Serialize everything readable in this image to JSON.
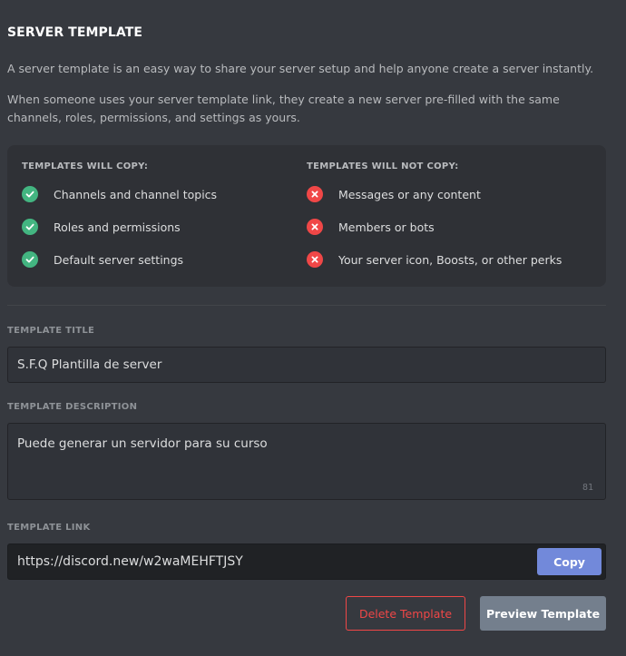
{
  "header": {
    "title": "SERVER TEMPLATE",
    "description_1": "A server template is an easy way to share your server setup and help anyone create a server instantly.",
    "description_2": "When someone uses your server template link, they create a new server pre-filled with the same channels, roles, permissions, and settings as yours."
  },
  "copy_info": {
    "will_copy": {
      "heading": "TEMPLATES WILL COPY:",
      "items": [
        "Channels and channel topics",
        "Roles and permissions",
        "Default server settings"
      ]
    },
    "will_not_copy": {
      "heading": "TEMPLATES WILL NOT COPY:",
      "items": [
        "Messages or any content",
        "Members or bots",
        "Your server icon, Boosts, or other perks"
      ]
    }
  },
  "template_title": {
    "label": "TEMPLATE TITLE",
    "value": "S.F.Q Plantilla de server"
  },
  "template_description": {
    "label": "TEMPLATE DESCRIPTION",
    "value": "Puede generar un servidor para su curso",
    "remaining_chars": "81"
  },
  "template_link": {
    "label": "TEMPLATE LINK",
    "url": "https://discord.new/w2waMEHFTJSY",
    "copy_label": "Copy"
  },
  "actions": {
    "delete_label": "Delete Template",
    "preview_label": "Preview Template"
  },
  "icons": {
    "will_copy": "check-circle-icon",
    "will_not_copy": "x-circle-icon"
  },
  "colors": {
    "background": "#36393f",
    "panel": "#2f3136",
    "success": "#43b581",
    "danger": "#f04747",
    "brand": "#7289da",
    "secondary_button": "#747f8d"
  }
}
